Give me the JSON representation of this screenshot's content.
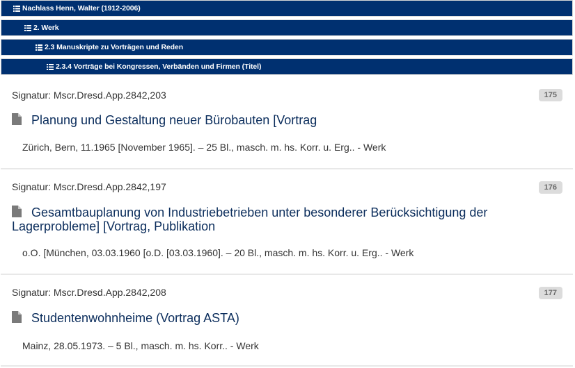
{
  "breadcrumbs": [
    {
      "label": "Nachlass Henn, Walter (1912-2006)"
    },
    {
      "label": "2. Werk"
    },
    {
      "label": "2.3 Manuskripte zu Vorträgen und Reden"
    },
    {
      "label": "2.3.4 Vorträge bei Kongressen, Verbänden und Firmen (Titel)"
    }
  ],
  "records": [
    {
      "signature": "Signatur: Mscr.Dresd.App.2842,203",
      "number": "175",
      "title": "Planung und Gestaltung neuer Bürobauten [Vortrag",
      "meta": "Zürich, Bern, 11.1965 [November 1965]. – 25 Bl., masch. m. hs. Korr. u. Erg.. - Werk"
    },
    {
      "signature": "Signatur: Mscr.Dresd.App.2842,197",
      "number": "176",
      "title": "Gesamtbauplanung von Industriebetrieben unter besonderer Berücksichtigung der Lagerprobleme] [Vortrag, Publikation",
      "meta": "o.O. [München, 03.03.1960 [o.D. [03.03.1960]. – 20 Bl., masch. m. hs. Korr. u. Erg.. - Werk"
    },
    {
      "signature": "Signatur: Mscr.Dresd.App.2842,208",
      "number": "177",
      "title": "Studentenwohnheime (Vortrag ASTA)",
      "meta": "Mainz, 28.05.1973. – 5 Bl., masch. m. hs. Korr.. - Werk"
    }
  ],
  "icons": {
    "breadcrumb": "list-icon",
    "record": "document-icon"
  },
  "colors": {
    "breadcrumb_bg": "#003070",
    "title": "#0b2d5c",
    "badge_bg": "#dcdcdc"
  }
}
